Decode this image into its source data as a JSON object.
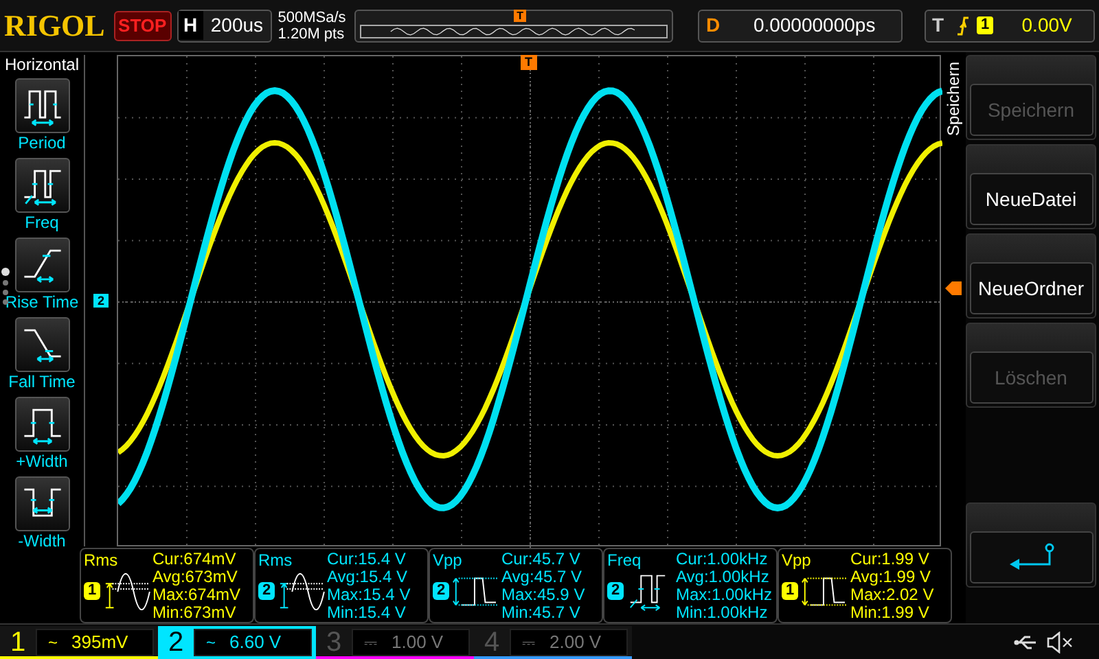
{
  "top_bar": {
    "brand": "RIGOL",
    "run_state": "STOP",
    "horizontal": {
      "label": "H",
      "timebase": "200us",
      "sample_rate": "500MSa/s",
      "points": "1.20M pts"
    },
    "trigger_position": "T",
    "delay": {
      "label": "D",
      "value": "0.00000000ps"
    },
    "trigger": {
      "label": "T",
      "source": "1",
      "level": "0.00V"
    }
  },
  "left_menu": {
    "title": "Horizontal",
    "items": [
      {
        "kind": "period",
        "label": "Period"
      },
      {
        "kind": "freq",
        "label": "Freq"
      },
      {
        "kind": "rise",
        "label": "Rise Time"
      },
      {
        "kind": "fall",
        "label": "Fall Time"
      },
      {
        "kind": "pwidth",
        "label": "+Width"
      },
      {
        "kind": "nwidth",
        "label": "-Width"
      }
    ],
    "pages": [
      {
        "selected": true
      },
      {
        "selected": false
      },
      {
        "selected": false
      },
      {
        "selected": false
      }
    ]
  },
  "screen": {
    "channel_marker": "2",
    "trigger_marker_top": "T"
  },
  "right_menu": {
    "title": "Speichern",
    "softkeys": [
      {
        "kind": "text",
        "label": "Speichern",
        "disabled": true
      },
      {
        "kind": "text",
        "label": "NeueDatei",
        "disabled": false
      },
      {
        "kind": "text",
        "label": "NeueOrdner",
        "disabled": false
      },
      {
        "kind": "text",
        "label": "Löschen",
        "disabled": true
      },
      {
        "kind": "back"
      }
    ]
  },
  "measurements": [
    {
      "name": "Rms",
      "channel": "1",
      "color": "#ffff00",
      "kind": "rms",
      "cur": "Cur:674mV",
      "avg": "Avg:673mV",
      "max": "Max:674mV",
      "min": "Min:673mV"
    },
    {
      "name": "Rms",
      "channel": "2",
      "color": "#00e5ff",
      "kind": "rms",
      "cur": "Cur:15.4 V",
      "avg": "Avg:15.4 V",
      "max": "Max:15.4 V",
      "min": "Min:15.4 V"
    },
    {
      "name": "Vpp",
      "channel": "2",
      "color": "#00e5ff",
      "kind": "vpp",
      "cur": "Cur:45.7 V",
      "avg": "Avg:45.7 V",
      "max": "Max:45.9 V",
      "min": "Min:45.7 V"
    },
    {
      "name": "Freq",
      "channel": "2",
      "color": "#00e5ff",
      "kind": "freq",
      "cur": "Cur:1.00kHz",
      "avg": "Avg:1.00kHz",
      "max": "Max:1.00kHz",
      "min": "Min:1.00kHz"
    },
    {
      "name": "Vpp",
      "channel": "1",
      "color": "#ffff00",
      "kind": "vpp",
      "cur": "Cur:1.99 V",
      "avg": "Avg:1.99 V",
      "max": "Max:2.02 V",
      "min": "Min:1.99 V"
    }
  ],
  "channels": [
    {
      "number": "1",
      "coupling": "~",
      "scale": "395mV",
      "color": "#ffff00",
      "on": true,
      "selected": false
    },
    {
      "number": "2",
      "coupling": "~",
      "scale": "6.60 V",
      "color": "#00e5ff",
      "on": true,
      "selected": true
    },
    {
      "number": "3",
      "coupling": "⎓",
      "scale": "1.00 V",
      "color": "#ff00ff",
      "on": false,
      "selected": false
    },
    {
      "number": "4",
      "coupling": "⎓",
      "scale": "2.00 V",
      "color": "#3399ff",
      "on": false,
      "selected": false
    }
  ]
}
